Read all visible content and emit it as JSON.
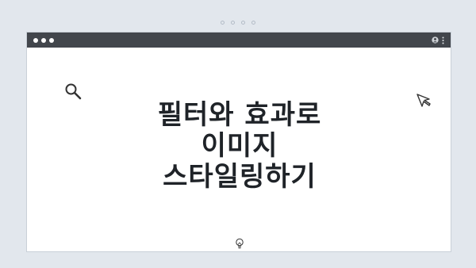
{
  "title_lines": [
    "필터와 효과로",
    "이미지",
    "스타일링하기"
  ],
  "icons": {
    "window_controls": "traffic-light-dots",
    "account": "user-icon",
    "menu": "kebab-icon",
    "search": "search-icon",
    "cursor": "cursor-arrow-icon",
    "hint": "lightbulb-icon"
  },
  "colors": {
    "background": "#e2e7ed",
    "titlebar": "#42464c",
    "window": "#ffffff",
    "text": "#1f2328"
  }
}
